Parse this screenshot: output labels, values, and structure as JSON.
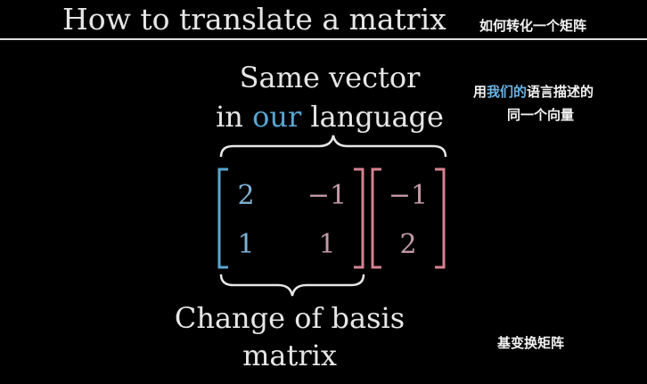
{
  "header": {
    "title": "How to translate a matrix",
    "title_cn": "如何转化一个矩阵"
  },
  "top_label": {
    "line1": "Same vector",
    "line2_prefix": "in ",
    "line2_highlight": "our",
    "line2_suffix": " language"
  },
  "top_label_cn": {
    "line1_prefix": "用",
    "line1_highlight": "我们的",
    "line1_suffix": "语言描述的",
    "line2": "同一个向量"
  },
  "matrix": {
    "a11": "2",
    "a12": "−1",
    "a21": "1",
    "a22": "1"
  },
  "vector": {
    "v1": "−1",
    "v2": "2"
  },
  "bottom_label": {
    "line1": "Change of basis",
    "line2": "matrix"
  },
  "bottom_label_cn": "基变换矩阵",
  "colors": {
    "blue": "#58a6d0",
    "pink": "#d4828f",
    "text": "#e6e6e6"
  }
}
